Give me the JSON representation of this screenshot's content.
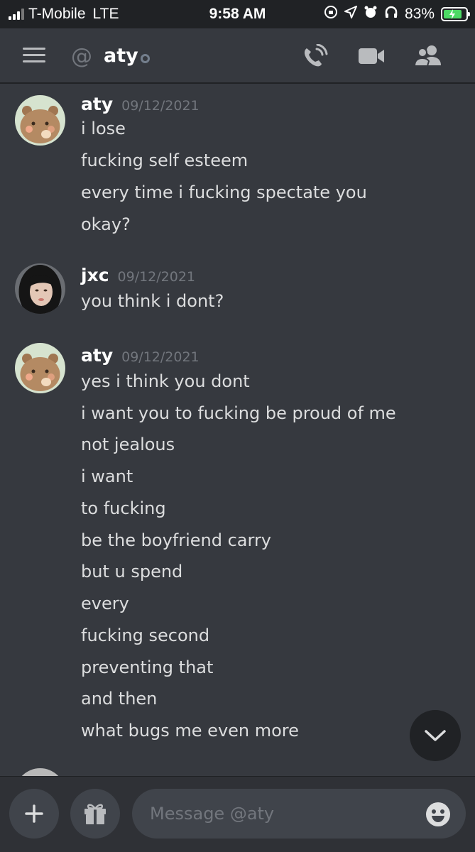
{
  "status_bar": {
    "carrier": "T-Mobile",
    "network": "LTE",
    "time": "9:58 AM",
    "battery": "83%",
    "battery_level": 0.83
  },
  "header": {
    "at_symbol": "@",
    "channel_name": "aty",
    "icons": [
      "phone-call-icon",
      "video-camera-icon",
      "members-icon"
    ]
  },
  "messages": [
    {
      "author": "aty",
      "timestamp": "09/12/2021",
      "avatar": "bear-avatar",
      "lines": [
        "i lose",
        "fucking self esteem",
        "every time i fucking spectate you",
        "okay?"
      ]
    },
    {
      "author": "jxc",
      "timestamp": "09/12/2021",
      "avatar": "photo-avatar",
      "lines": [
        "you think i dont?"
      ]
    },
    {
      "author": "aty",
      "timestamp": "09/12/2021",
      "avatar": "bear-avatar",
      "lines": [
        "yes i think you dont",
        "i want you to fucking be proud of me",
        "not jealous",
        "i want",
        "to fucking",
        "be the boyfriend carry",
        "but u spend",
        "every",
        "fucking second",
        "preventing that",
        "and then",
        "what bugs me even more"
      ]
    }
  ],
  "composer": {
    "placeholder": "Message @aty",
    "icons": [
      "plus-icon",
      "gift-icon",
      "emoji-icon"
    ]
  },
  "colors": {
    "background": "#36393f",
    "bar": "#202225",
    "input": "#40444b",
    "muted": "#72767d",
    "text": "#dcddde"
  }
}
